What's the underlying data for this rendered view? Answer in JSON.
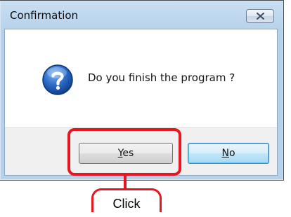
{
  "dialog": {
    "title": "Confirmation",
    "message": "Do you finish the program ?",
    "icon": "question-icon",
    "close_icon": "close-icon"
  },
  "buttons": {
    "yes": {
      "prefix": "",
      "mnemonic": "Y",
      "rest": "es"
    },
    "no": {
      "prefix": "",
      "mnemonic": "N",
      "rest": "o"
    }
  },
  "annotation": {
    "label": "Click",
    "color": "#e8141e"
  },
  "colors": {
    "titlebar": "#c9dff2",
    "button_bar": "#f0f0f0",
    "focused_button_border": "#3c7fb1"
  }
}
